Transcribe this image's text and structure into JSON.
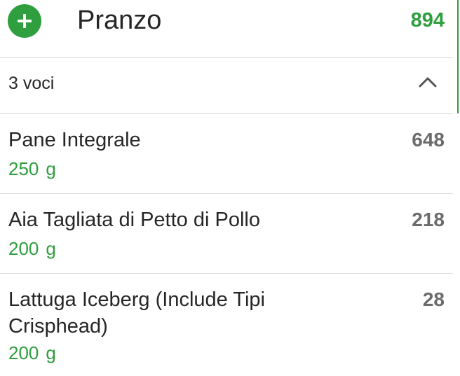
{
  "meal": {
    "title": "Pranzo",
    "total_calories": "894",
    "add_icon": "plus-icon"
  },
  "summary": {
    "count_label": "3 voci",
    "toggle_icon": "chevron-up-icon"
  },
  "items": [
    {
      "name": "Pane Integrale",
      "quantity": "250",
      "unit": "g",
      "calories": "648"
    },
    {
      "name": "Aia Tagliata di Petto di Pollo",
      "quantity": "200",
      "unit": "g",
      "calories": "218"
    },
    {
      "name": "Lattuga Iceberg (Include Tipi Crisphead)",
      "quantity": "200",
      "unit": "g",
      "calories": "28"
    }
  ],
  "colors": {
    "accent_green": "#2e9e3e",
    "calorie_gray": "#6b6b6b",
    "divider": "#dcdcdc"
  }
}
